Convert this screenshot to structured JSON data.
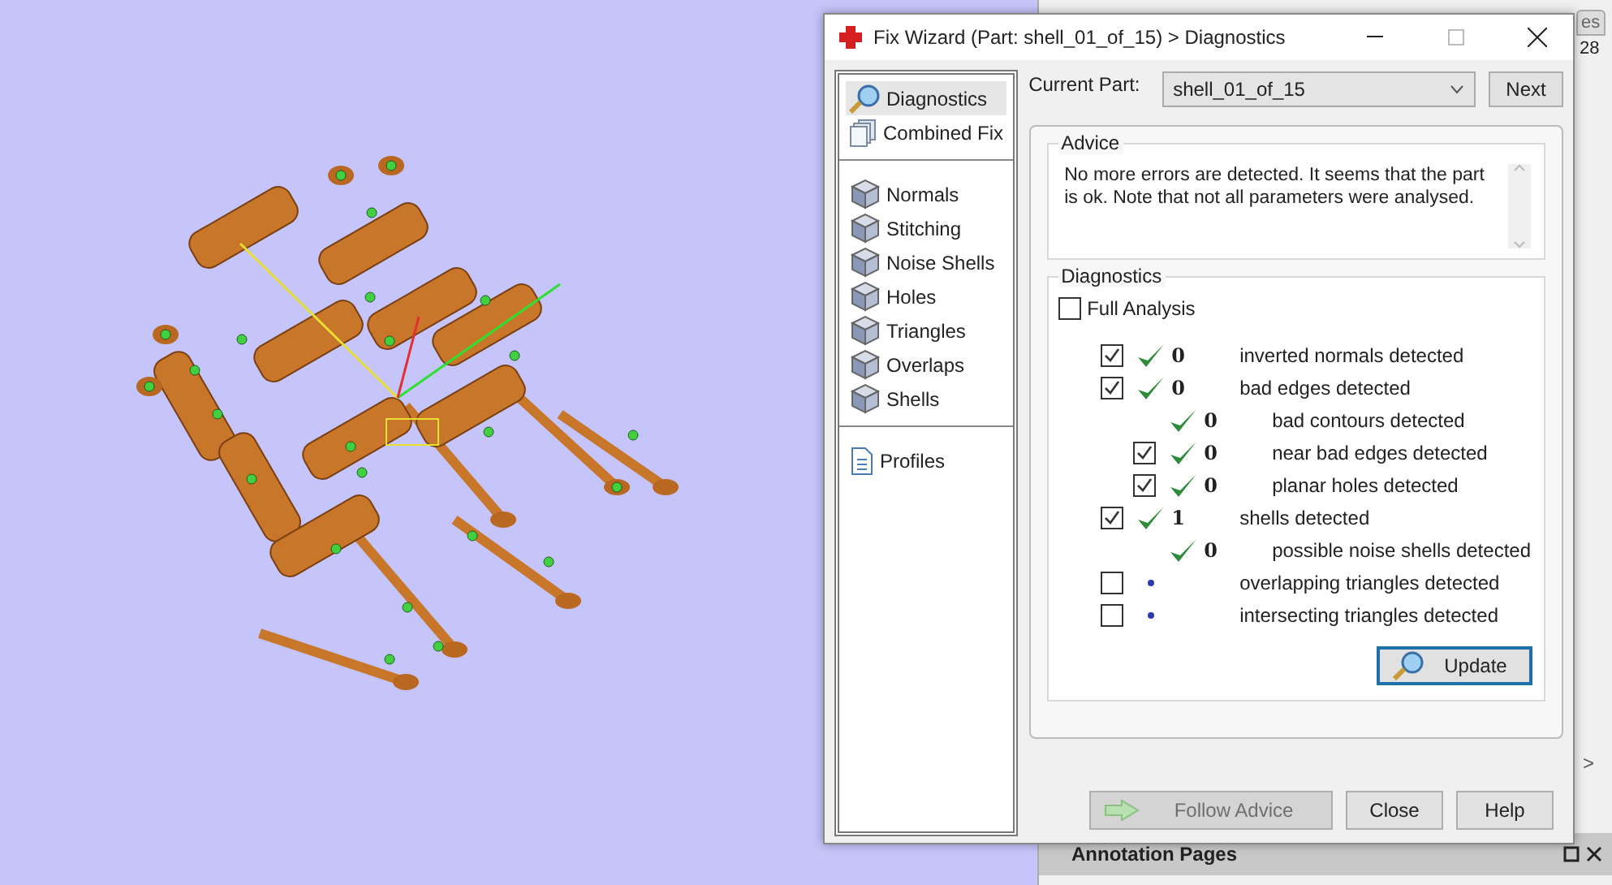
{
  "background_panel": {
    "tab": "es",
    "count": "28",
    "scroll_arrow": ">",
    "annotation_header": "Annotation Pages"
  },
  "window": {
    "title": "Fix Wizard (Part: shell_01_of_15) > Diagnostics"
  },
  "sidebar": {
    "groups": [
      [
        {
          "label": "Diagnostics",
          "kind": "search",
          "selected": true
        },
        {
          "label": "Combined Fix",
          "kind": "stack",
          "selected": false
        }
      ],
      [
        {
          "label": "Normals",
          "kind": "cube",
          "selected": false
        },
        {
          "label": "Stitching",
          "kind": "cube",
          "selected": false
        },
        {
          "label": "Noise Shells",
          "kind": "cube",
          "selected": false
        },
        {
          "label": "Holes",
          "kind": "cube",
          "selected": false
        },
        {
          "label": "Triangles",
          "kind": "cube",
          "selected": false
        },
        {
          "label": "Overlaps",
          "kind": "cube",
          "selected": false
        },
        {
          "label": "Shells",
          "kind": "cube",
          "selected": false
        }
      ],
      [
        {
          "label": "Profiles",
          "kind": "document",
          "selected": false
        }
      ]
    ]
  },
  "current_part": {
    "label": "Current Part:",
    "value": "shell_01_of_15",
    "next": "Next"
  },
  "advice": {
    "title": "Advice",
    "text": "No more errors are detected. It seems that the part is ok. Note that not all parameters were analysed."
  },
  "diagnostics": {
    "title": "Diagnostics",
    "full_analysis": {
      "label": "Full Analysis",
      "checked": false
    },
    "rows": [
      {
        "label": "inverted normals detected",
        "count": "0",
        "kind": "ok",
        "checked": true
      },
      {
        "label": "bad edges detected",
        "count": "0",
        "kind": "ok",
        "checked": true,
        "children": [
          {
            "label": "bad contours detected",
            "count": "0",
            "kind": "ok"
          },
          {
            "label": "near bad edges detected",
            "count": "0",
            "kind": "ok",
            "checked": true
          },
          {
            "label": "planar holes detected",
            "count": "0",
            "kind": "ok",
            "checked": true
          }
        ]
      },
      {
        "label": "shells detected",
        "count": "1",
        "kind": "ok",
        "checked": true,
        "children": [
          {
            "label": "possible noise shells detected",
            "count": "0",
            "kind": "ok"
          }
        ]
      },
      {
        "label": "overlapping triangles detected",
        "kind": "pending",
        "checked": false
      },
      {
        "label": "intersecting triangles detected",
        "kind": "pending",
        "checked": false
      }
    ],
    "update": "Update"
  },
  "buttons": [
    {
      "label": "Follow Advice",
      "kind": "arrow",
      "disabled": true
    },
    {
      "label": "Close",
      "kind": "plain",
      "disabled": false
    },
    {
      "label": "Help",
      "kind": "plain",
      "disabled": false
    }
  ]
}
